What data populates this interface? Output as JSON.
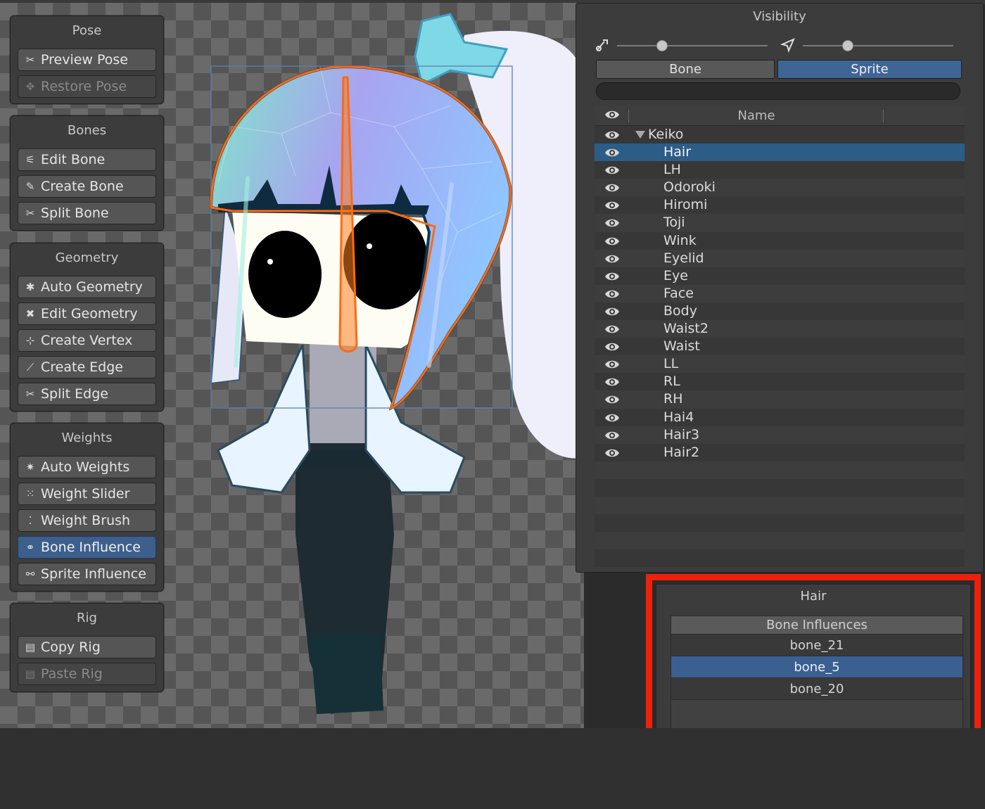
{
  "tool_panels": [
    {
      "title": "Pose",
      "buttons": [
        {
          "label": "Preview Pose",
          "icon": "preview-pose-icon",
          "state": "normal"
        },
        {
          "label": "Restore Pose",
          "icon": "restore-pose-icon",
          "state": "disabled"
        }
      ]
    },
    {
      "title": "Bones",
      "buttons": [
        {
          "label": "Edit Bone",
          "icon": "edit-bone-icon",
          "state": "normal"
        },
        {
          "label": "Create Bone",
          "icon": "create-bone-icon",
          "state": "normal"
        },
        {
          "label": "Split Bone",
          "icon": "split-bone-icon",
          "state": "normal"
        }
      ]
    },
    {
      "title": "Geometry",
      "buttons": [
        {
          "label": "Auto Geometry",
          "icon": "auto-geometry-icon",
          "state": "normal"
        },
        {
          "label": "Edit Geometry",
          "icon": "edit-geometry-icon",
          "state": "normal"
        },
        {
          "label": "Create Vertex",
          "icon": "create-vertex-icon",
          "state": "normal"
        },
        {
          "label": "Create Edge",
          "icon": "create-edge-icon",
          "state": "normal"
        },
        {
          "label": "Split Edge",
          "icon": "split-edge-icon",
          "state": "normal"
        }
      ]
    },
    {
      "title": "Weights",
      "buttons": [
        {
          "label": "Auto Weights",
          "icon": "auto-weights-icon",
          "state": "normal"
        },
        {
          "label": "Weight Slider",
          "icon": "weight-slider-icon",
          "state": "normal"
        },
        {
          "label": "Weight Brush",
          "icon": "weight-brush-icon",
          "state": "normal"
        },
        {
          "label": "Bone Influence",
          "icon": "bone-influence-icon",
          "state": "active"
        },
        {
          "label": "Sprite Influence",
          "icon": "sprite-influence-icon",
          "state": "normal"
        }
      ]
    },
    {
      "title": "Rig",
      "buttons": [
        {
          "label": "Copy Rig",
          "icon": "copy-rig-icon",
          "state": "normal"
        },
        {
          "label": "Paste Rig",
          "icon": "paste-rig-icon",
          "state": "disabled"
        }
      ]
    }
  ],
  "visibility": {
    "title": "Visibility",
    "bone_opacity": 0.3,
    "sprite_opacity": 0.3,
    "tabs": {
      "bone": "Bone",
      "sprite": "Sprite",
      "active": "sprite"
    },
    "search": {
      "value": "",
      "placeholder": ""
    },
    "header_name": "Name",
    "root": "Keiko",
    "selected": "Hair",
    "sprites": [
      "Hair",
      "LH",
      "Odoroki",
      "Hiromi",
      "Toji",
      "Wink",
      "Eyelid",
      "Eye",
      "Face",
      "Body",
      "Waist2",
      "Waist",
      "LL",
      "RL",
      "RH",
      "Hai4",
      "Hair3",
      "Hair2"
    ]
  },
  "influence": {
    "title": "Hair",
    "header": "Bone Influences",
    "items": [
      "bone_21",
      "bone_5",
      "bone_20"
    ],
    "selected": "bone_5",
    "add_label": "+",
    "remove_label": "−"
  },
  "colors": {
    "accent": "#3e6596",
    "selection": "#2c5d87",
    "outline": "#ff6a10",
    "highlight_box": "#f0200a"
  }
}
